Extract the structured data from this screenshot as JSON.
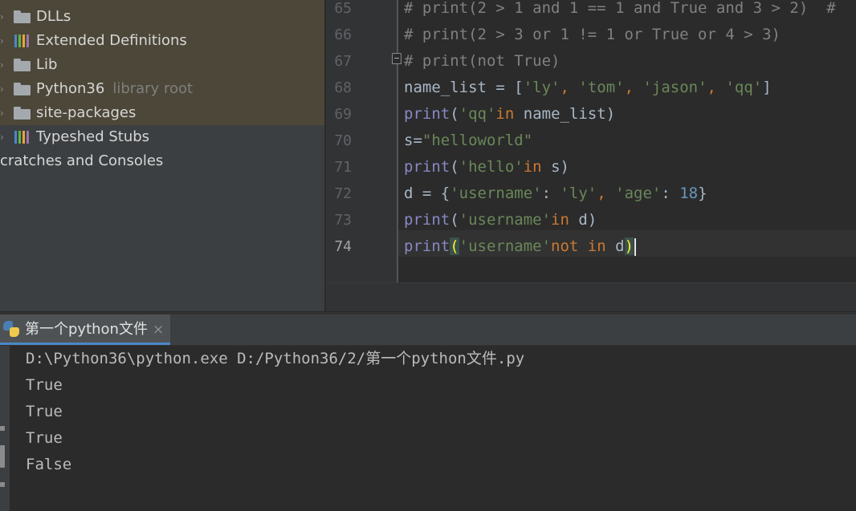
{
  "project_tree": {
    "items": [
      {
        "label": "DLLs",
        "icon": "folder-icon"
      },
      {
        "label": "Extended Definitions",
        "icon": "library-icon"
      },
      {
        "label": "Lib",
        "icon": "folder-icon"
      },
      {
        "label": "Python36",
        "hint": "library root",
        "icon": "folder-icon"
      },
      {
        "label": "site-packages",
        "icon": "folder-icon"
      },
      {
        "label": "Typeshed Stubs",
        "icon": "library-icon"
      },
      {
        "label": "cratches and Consoles"
      }
    ]
  },
  "editor": {
    "line_numbers": [
      "65",
      "66",
      "67",
      "68",
      "69",
      "70",
      "71",
      "72",
      "73",
      "74"
    ],
    "current_line": "74",
    "lines": [
      [
        {
          "t": "# print(2 > 1 and 1 == 1 and True and 3 > 2)  #",
          "c": "cmt"
        }
      ],
      [
        {
          "t": "# print(2 > 3 or 1 != 1 or True or 4 > 3)",
          "c": "cmt"
        }
      ],
      [
        {
          "t": "# print(not True)",
          "c": "cmt"
        }
      ],
      [
        {
          "t": "name_list = [",
          "c": ""
        },
        {
          "t": "'ly'",
          "c": "str"
        },
        {
          "t": ", ",
          "c": "kw"
        },
        {
          "t": "'tom'",
          "c": "str"
        },
        {
          "t": ", ",
          "c": "kw"
        },
        {
          "t": "'jason'",
          "c": "str"
        },
        {
          "t": ", ",
          "c": "kw"
        },
        {
          "t": "'qq'",
          "c": "str"
        },
        {
          "t": "]",
          "c": ""
        }
      ],
      [
        {
          "t": "print",
          "c": "bi"
        },
        {
          "t": "(",
          "c": ""
        },
        {
          "t": "'qq'",
          "c": "str"
        },
        {
          "t": "in",
          "c": "kw"
        },
        {
          "t": " name_list)",
          "c": ""
        }
      ],
      [
        {
          "t": "s=",
          "c": ""
        },
        {
          "t": "\"helloworld\"",
          "c": "str"
        }
      ],
      [
        {
          "t": "print",
          "c": "bi"
        },
        {
          "t": "(",
          "c": ""
        },
        {
          "t": "'hello'",
          "c": "str"
        },
        {
          "t": "in",
          "c": "kw"
        },
        {
          "t": " s)",
          "c": ""
        }
      ],
      [
        {
          "t": "d = {",
          "c": ""
        },
        {
          "t": "'username'",
          "c": "str"
        },
        {
          "t": ": ",
          "c": ""
        },
        {
          "t": "'ly'",
          "c": "str"
        },
        {
          "t": ", ",
          "c": "kw"
        },
        {
          "t": "'age'",
          "c": "str"
        },
        {
          "t": ": ",
          "c": ""
        },
        {
          "t": "18",
          "c": "num"
        },
        {
          "t": "}",
          "c": ""
        }
      ],
      [
        {
          "t": "print",
          "c": "bi"
        },
        {
          "t": "(",
          "c": ""
        },
        {
          "t": "'username'",
          "c": "str"
        },
        {
          "t": "in",
          "c": "kw"
        },
        {
          "t": " d)",
          "c": ""
        }
      ],
      [
        {
          "t": "print",
          "c": "bi"
        },
        {
          "t": "(",
          "c": "brk"
        },
        {
          "t": "'username'",
          "c": "str"
        },
        {
          "t": "not in",
          "c": "kw"
        },
        {
          "t": " d",
          "c": ""
        },
        {
          "t": ")",
          "c": "brk"
        }
      ]
    ]
  },
  "run_panel": {
    "tab_label": "第一个python文件",
    "close_glyph": "×",
    "output": [
      "D:\\Python36\\python.exe D:/Python36/2/第一个python文件.py",
      "True",
      "True",
      "True",
      "False"
    ]
  },
  "colors": {
    "library_bars": [
      "#4a88c7",
      "#62b543",
      "#e8a33d",
      "#9876aa"
    ]
  }
}
